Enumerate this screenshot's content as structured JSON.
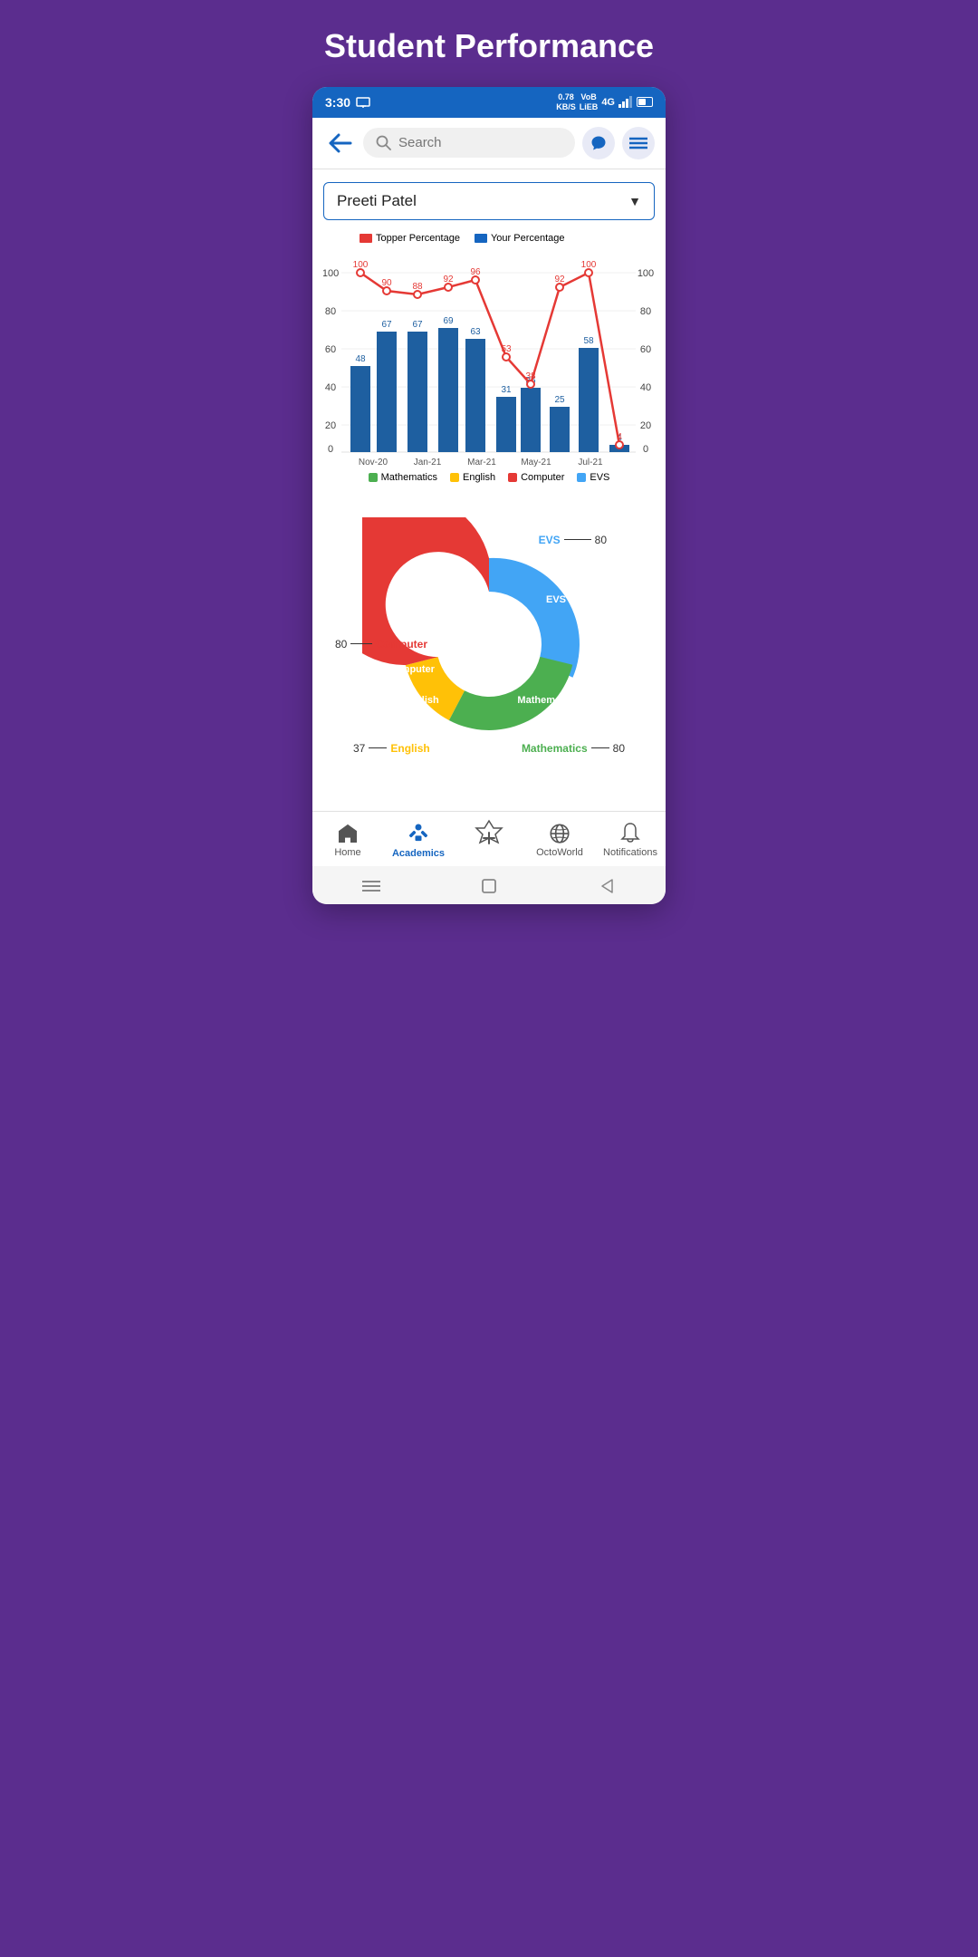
{
  "page": {
    "title": "Student Performance"
  },
  "statusBar": {
    "time": "3:30",
    "network": "0.78 KB/S",
    "voip": "VoB LiEB",
    "signal": "4G"
  },
  "topNav": {
    "searchPlaceholder": "Search"
  },
  "studentDropdown": {
    "name": "Preeti Patel"
  },
  "chart": {
    "legend": [
      {
        "label": "Topper Percentage",
        "color": "#e53935"
      },
      {
        "label": "Your Percentage",
        "color": "#1565c0"
      }
    ],
    "months": [
      "Nov-20",
      "Jan-21",
      "Mar-21",
      "May-21",
      "Jul-21"
    ],
    "bars": [
      48,
      67,
      67,
      69,
      63,
      31,
      36,
      25,
      58,
      4
    ],
    "topperLine": [
      100,
      90,
      88,
      92,
      96,
      53,
      38,
      92,
      100,
      4
    ],
    "legendBottom": [
      {
        "label": "Mathematics",
        "color": "#4caf50"
      },
      {
        "label": "English",
        "color": "#ffc107"
      },
      {
        "label": "Computer",
        "color": "#e53935"
      },
      {
        "label": "EVS",
        "color": "#42a5f5"
      }
    ]
  },
  "donutChart": {
    "segments": [
      {
        "label": "EVS",
        "value": 80,
        "color": "#42a5f5",
        "textColor": "white"
      },
      {
        "label": "Mathematics",
        "value": 80,
        "color": "#4caf50",
        "textColor": "white"
      },
      {
        "label": "English",
        "value": 37,
        "color": "#ffc107",
        "textColor": "white"
      },
      {
        "label": "Computer",
        "value": 80,
        "color": "#e53935",
        "textColor": "white"
      }
    ],
    "labels": {
      "evs": "EVS",
      "evsVal": "80",
      "math": "Mathematics",
      "mathVal": "80",
      "english": "English",
      "englishVal": "37",
      "computer": "Computer",
      "computerVal": "80"
    }
  },
  "bottomNav": {
    "items": [
      {
        "label": "Home",
        "active": false
      },
      {
        "label": "Academics",
        "active": true
      },
      {
        "label": "",
        "active": false
      },
      {
        "label": "OctoWorld",
        "active": false
      },
      {
        "label": "Notifications",
        "active": false
      }
    ]
  }
}
